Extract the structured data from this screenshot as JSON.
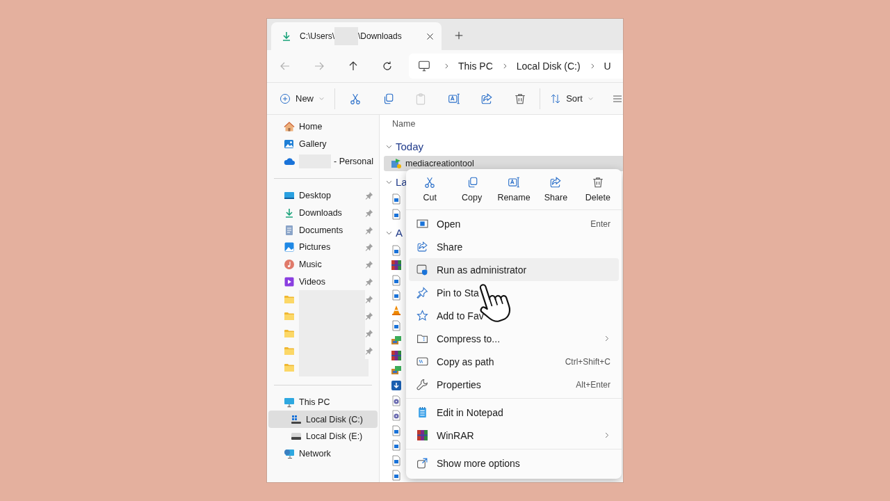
{
  "tab": {
    "title_start": "C:\\Users\\",
    "title_end": "\\Downloads",
    "redacted": true
  },
  "nav": [
    {
      "kind": "back",
      "disabled": true
    },
    {
      "kind": "forward",
      "disabled": true
    },
    {
      "kind": "up",
      "disabled": false
    },
    {
      "kind": "refresh",
      "disabled": false
    }
  ],
  "breadcrumb": [
    "This PC",
    "Local Disk (C:)",
    "U"
  ],
  "toolbar": {
    "new_label": "New",
    "sort_label": "Sort",
    "actions": [
      {
        "kind": "cut",
        "disabled": false
      },
      {
        "kind": "copy",
        "disabled": false
      },
      {
        "kind": "paste",
        "disabled": true
      },
      {
        "kind": "rename",
        "disabled": false
      },
      {
        "kind": "share",
        "disabled": false
      },
      {
        "kind": "delete",
        "disabled": false
      }
    ]
  },
  "sidebar": {
    "sections": [
      [
        {
          "kind": "home",
          "label": "Home",
          "pinned": false,
          "redacted": false,
          "selected": false
        },
        {
          "kind": "gallery",
          "label": "Gallery",
          "pinned": false,
          "redacted": false,
          "selected": false
        },
        {
          "kind": "cloud",
          "label": "- Personal",
          "pinned": false,
          "redacted": true,
          "selected": false
        }
      ],
      [
        {
          "kind": "desktop",
          "label": "Desktop",
          "pinned": true,
          "redacted": false,
          "selected": false
        },
        {
          "kind": "downloads",
          "label": "Downloads",
          "pinned": true,
          "redacted": false,
          "selected": false
        },
        {
          "kind": "documents",
          "label": "Documents",
          "pinned": true,
          "redacted": false,
          "selected": false
        },
        {
          "kind": "pictures",
          "label": "Pictures",
          "pinned": true,
          "redacted": false,
          "selected": false
        },
        {
          "kind": "music",
          "label": "Music",
          "pinned": true,
          "redacted": false,
          "selected": false
        },
        {
          "kind": "videos",
          "label": "Videos",
          "pinned": true,
          "redacted": false,
          "selected": false
        },
        {
          "kind": "folder",
          "pinned": true,
          "redacted": true,
          "selected": false
        },
        {
          "kind": "folder",
          "pinned": true,
          "redacted": true,
          "selected": false
        },
        {
          "kind": "folder",
          "pinned": true,
          "redacted": true,
          "selected": false
        },
        {
          "kind": "folder",
          "pinned": true,
          "redacted": true,
          "selected": false
        },
        {
          "kind": "folder",
          "pinned": false,
          "redacted": true,
          "selected": false
        }
      ],
      [
        {
          "kind": "thispc",
          "label": "This PC",
          "pinned": false,
          "redacted": false,
          "selected": false,
          "children": [
            {
              "kind": "disk_c",
              "label": "Local Disk (C:)",
              "pinned": false,
              "redacted": false,
              "selected": true
            },
            {
              "kind": "disk_e",
              "label": "Local Disk (E:)",
              "pinned": false,
              "redacted": false,
              "selected": false
            }
          ]
        },
        {
          "kind": "network",
          "label": "Network",
          "pinned": false,
          "redacted": false,
          "selected": false
        }
      ]
    ]
  },
  "file_list": {
    "column": "Name",
    "groups": [
      {
        "label": "Today",
        "expanded": true,
        "files": [
          {
            "kind": "installer",
            "name": "mediacreationtool",
            "selected": true
          }
        ]
      },
      {
        "label": "La",
        "expanded": true,
        "files": [
          {
            "kind": "doc",
            "selected": false
          },
          {
            "kind": "doc",
            "selected": false
          }
        ]
      },
      {
        "label": "A",
        "expanded": true,
        "files": [
          {
            "kind": "doc",
            "selected": false
          },
          {
            "kind": "rar",
            "selected": false
          },
          {
            "kind": "doc",
            "selected": false
          },
          {
            "kind": "doc",
            "selected": false
          },
          {
            "kind": "vlc",
            "selected": false
          },
          {
            "kind": "doc",
            "selected": false
          },
          {
            "kind": "pkg",
            "selected": false
          },
          {
            "kind": "rar",
            "selected": false
          },
          {
            "kind": "pkg",
            "selected": false
          },
          {
            "kind": "dl",
            "selected": false
          },
          {
            "kind": "disc",
            "selected": false
          },
          {
            "kind": "disc",
            "selected": false
          },
          {
            "kind": "doc",
            "selected": false
          },
          {
            "kind": "doc",
            "selected": false
          },
          {
            "kind": "doc",
            "selected": false
          },
          {
            "kind": "doc",
            "selected": false
          }
        ]
      }
    ]
  },
  "context_menu": {
    "actions": [
      {
        "kind": "cut",
        "label": "Cut"
      },
      {
        "kind": "copy",
        "label": "Copy"
      },
      {
        "kind": "rename",
        "label": "Rename"
      },
      {
        "kind": "share",
        "label": "Share"
      },
      {
        "kind": "delete",
        "label": "Delete"
      }
    ],
    "sections": [
      [
        {
          "kind": "open",
          "label": "Open",
          "shortcut": "Enter",
          "submenu": false,
          "selected": false
        },
        {
          "kind": "share",
          "label": "Share",
          "submenu": false,
          "selected": false
        },
        {
          "kind": "admin",
          "label": "Run as administrator",
          "submenu": false,
          "selected": true
        },
        {
          "kind": "pinstart",
          "label": "Pin to Sta",
          "submenu": false,
          "selected": false
        },
        {
          "kind": "star",
          "label": "Add to Fav",
          "submenu": false,
          "selected": false
        },
        {
          "kind": "compress",
          "label": "Compress to...",
          "submenu": true,
          "selected": false
        },
        {
          "kind": "copypath",
          "label": "Copy as path",
          "shortcut": "Ctrl+Shift+C",
          "submenu": false,
          "selected": false
        },
        {
          "kind": "properties",
          "label": "Properties",
          "shortcut": "Alt+Enter",
          "submenu": false,
          "selected": false
        }
      ],
      [
        {
          "kind": "notepad",
          "label": "Edit in Notepad",
          "submenu": false,
          "selected": false
        },
        {
          "kind": "rar",
          "label": "WinRAR",
          "submenu": true,
          "selected": false
        }
      ],
      [
        {
          "kind": "more",
          "label": "Show more options",
          "submenu": false,
          "selected": false
        }
      ]
    ]
  }
}
